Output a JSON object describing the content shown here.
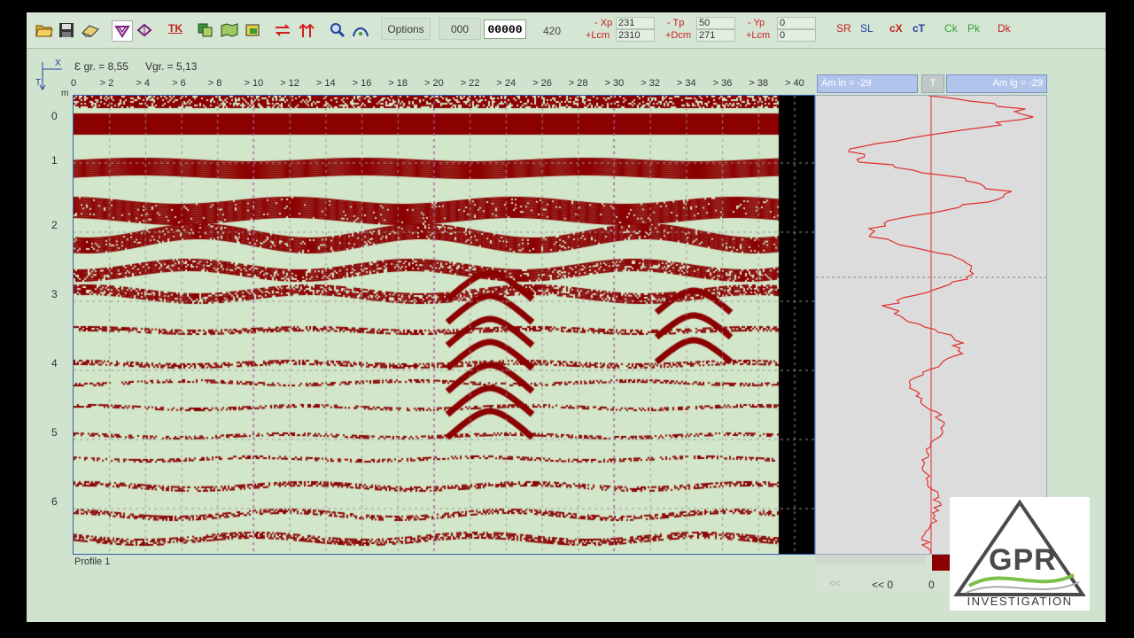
{
  "toolbar": {
    "icons": [
      "open-folder-icon",
      "save-icon",
      "erase-icon",
      "filter-v-icon",
      "filter-diamond-icon",
      "tk-icon",
      "layers-icon",
      "map-icon",
      "export-icon",
      "swap-horizontal-icon",
      "arrows-up-icon",
      "zoom-icon",
      "curve-icon"
    ],
    "tk_label": "TK",
    "options_label": "Options",
    "field_a": "000",
    "field_b": "00000",
    "value_420": "420",
    "readouts": {
      "xp_label": "- Xp",
      "xp_value": "231",
      "lcm_label": "+Lcm",
      "lcm_value": "2310",
      "tp_label": "- Tp",
      "tp_value": "50",
      "dcm_label": "+Dcm",
      "dcm_value": "271",
      "yp_label": "- Yp",
      "yp_value": "0",
      "lcm2_label": "+Lcm",
      "lcm2_value": "0"
    },
    "modes": [
      "SR",
      "SL",
      "cX",
      "cT",
      "Ck",
      "Pk",
      "Dk"
    ]
  },
  "header": {
    "eps_label": "Ɛ gr. = 8,55",
    "vgr_label": "Vgr. = 5,13",
    "axis_x_letter": "X",
    "axis_t_letter": "T",
    "unit_m": "m"
  },
  "x_ticks": [
    "0",
    "> 2",
    "> 4",
    "> 6",
    "> 8",
    "> 10",
    "> 12",
    "> 14",
    "> 16",
    "> 18",
    "> 20",
    "> 22",
    "> 24",
    "> 26",
    "> 28",
    "> 30",
    "> 32",
    "> 34",
    "> 36",
    "> 38",
    "> 40"
  ],
  "y_ticks": [
    "0",
    "1",
    "2",
    "3",
    "4",
    "5",
    "6"
  ],
  "profile_label": "Profile 1",
  "trace": {
    "am_ln": "Am ln = -29",
    "t_label": "T",
    "am_lg": "Am lg = -29",
    "nav_prev": "<<",
    "nav_prev_value": "<< 0",
    "nav_value": "0"
  },
  "logo": {
    "text": "GPR",
    "subtitle": "INVESTIGATION"
  },
  "colors": {
    "app_bg": "#cfe3cf",
    "reflector": "#8b0000",
    "background_band": "#d2e6c9",
    "trace_line": "#e03030",
    "accent_blue": "#3060b0"
  }
}
